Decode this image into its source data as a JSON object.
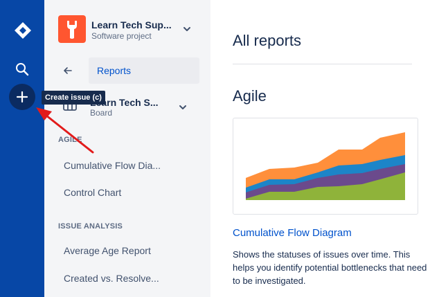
{
  "tooltip": {
    "text": "Create issue (c)"
  },
  "project": {
    "name": "Learn Tech Sup...",
    "type": "Software project"
  },
  "sidebar": {
    "back_label": "Reports",
    "board": {
      "name": "Learn Tech S...",
      "type": "Board"
    },
    "sections": [
      {
        "heading": "AGILE",
        "items": [
          "Cumulative Flow Dia...",
          "Control Chart"
        ]
      },
      {
        "heading": "ISSUE ANALYSIS",
        "items": [
          "Average Age Report",
          "Created vs. Resolve..."
        ]
      }
    ]
  },
  "main": {
    "title": "All reports",
    "section": "Agile",
    "report": {
      "name": "Cumulative Flow Diagram",
      "description": "Shows the statuses of issues over time. This helps you identify potential bottlenecks that need to be investigated."
    }
  },
  "colors": {
    "nav": "#0747a6",
    "accent": "#0052cc",
    "cfd": [
      "#8fb33a",
      "#6b4a8c",
      "#1c85c8",
      "#ff8f3b"
    ],
    "annotation_arrow": "#e21b1b"
  },
  "icons": [
    "jira-logo-icon",
    "search-icon",
    "plus-icon",
    "wrench-icon",
    "chevron-down-icon",
    "arrow-left-icon",
    "board-icon"
  ]
}
